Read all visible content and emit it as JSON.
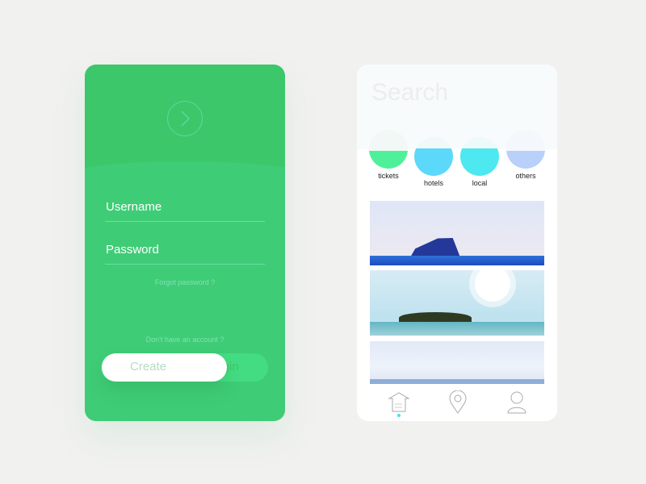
{
  "login": {
    "username_label": "Username",
    "password_label": "Password",
    "forgot": "Forgot password ?",
    "no_account": "Don't have an account ?",
    "create_label": "Create",
    "login_label": "Login"
  },
  "search": {
    "placeholder": "Search",
    "categories": [
      {
        "label": "tickets",
        "color": "#4ff09a"
      },
      {
        "label": "hotels",
        "color": "#5cd8fb"
      },
      {
        "label": "local",
        "color": "#4ee8f0"
      },
      {
        "label": "others",
        "color": "#b8d0fa"
      }
    ],
    "nav": [
      "home-icon",
      "location-pin-icon",
      "user-icon"
    ],
    "active_nav": 0,
    "accent": "#4fe0e0"
  }
}
